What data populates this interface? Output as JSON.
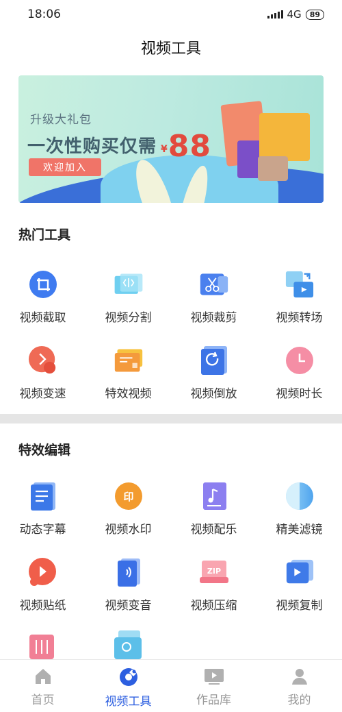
{
  "status_bar": {
    "time": "18:06",
    "network": "4G",
    "battery": "89"
  },
  "header": {
    "title": "视频工具"
  },
  "banner": {
    "subtitle": "升级大礼包",
    "headline": "一次性购买仅需",
    "currency": "¥",
    "price": "88",
    "button_label": "欢迎加入"
  },
  "hot_tools": {
    "title": "热门工具",
    "items": [
      {
        "label": "视频截取",
        "icon": "crop-icon"
      },
      {
        "label": "视频分割",
        "icon": "split-icon"
      },
      {
        "label": "视频裁剪",
        "icon": "scissors-icon"
      },
      {
        "label": "视频转场",
        "icon": "transition-icon"
      },
      {
        "label": "视频变速",
        "icon": "speed-icon"
      },
      {
        "label": "特效视频",
        "icon": "effects-icon"
      },
      {
        "label": "视频倒放",
        "icon": "reverse-icon"
      },
      {
        "label": "视频时长",
        "icon": "clock-icon"
      }
    ]
  },
  "effect_edit": {
    "title": "特效编辑",
    "items": [
      {
        "label": "动态字幕",
        "icon": "subtitle-icon"
      },
      {
        "label": "视频水印",
        "icon": "watermark-icon"
      },
      {
        "label": "视频配乐",
        "icon": "music-icon"
      },
      {
        "label": "精美滤镜",
        "icon": "filter-icon"
      },
      {
        "label": "视频贴纸",
        "icon": "sticker-icon"
      },
      {
        "label": "视频变音",
        "icon": "voice-change-icon"
      },
      {
        "label": "视频压缩",
        "icon": "zip-icon"
      },
      {
        "label": "视频复制",
        "icon": "copy-video-icon"
      }
    ]
  },
  "tab_bar": {
    "items": [
      {
        "label": "首页",
        "icon": "home-icon",
        "active": false
      },
      {
        "label": "视频工具",
        "icon": "video-tools-icon",
        "active": true
      },
      {
        "label": "作品库",
        "icon": "library-icon",
        "active": false
      },
      {
        "label": "我的",
        "icon": "profile-icon",
        "active": false
      }
    ]
  },
  "colors": {
    "accent": "#2d5fe0",
    "price_red": "#e24a3e",
    "button_red": "#f07468",
    "divider": "#e5e5e5"
  }
}
